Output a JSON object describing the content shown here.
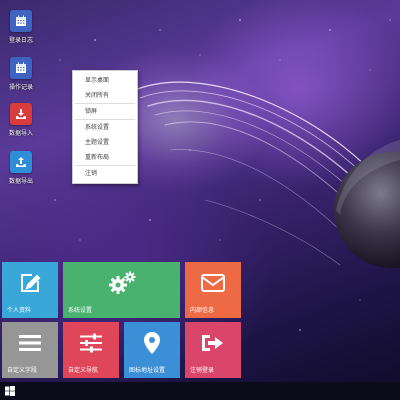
{
  "desktop_icons": [
    {
      "label": "登录日志",
      "icon": "calendar-icon",
      "color": "#3e63c0"
    },
    {
      "label": "操作记录",
      "icon": "calendar-icon",
      "color": "#3e63c0"
    },
    {
      "label": "数据导入",
      "icon": "download-icon",
      "color": "#d93c3c"
    },
    {
      "label": "数据导出",
      "icon": "upload-icon",
      "color": "#2f8ed8"
    }
  ],
  "context_menu": {
    "items": [
      "显示桌面",
      "关闭所有",
      "锁屏",
      "系统设置",
      "主题设置",
      "重新布局",
      "注销"
    ]
  },
  "tiles": [
    {
      "label": "个人资料",
      "icon": "edit-icon",
      "color": "#3aa7d9"
    },
    {
      "label": "系统设置",
      "icon": "gears-icon",
      "color": "#48b26e"
    },
    {
      "label": "内部信息",
      "icon": "mail-icon",
      "color": "#ee6a45"
    },
    {
      "label": "自定义字段",
      "icon": "menu-icon",
      "color": "#969696"
    },
    {
      "label": "自定义导航",
      "icon": "sliders-icon",
      "color": "#e0465a"
    },
    {
      "label": "图标地址设置",
      "icon": "map-marker-icon",
      "color": "#3b8fd6"
    },
    {
      "label": "注销登录",
      "icon": "sign-out-icon",
      "color": "#d9466a"
    }
  ],
  "taskbar": {
    "start_icon": "windows-logo-icon"
  }
}
